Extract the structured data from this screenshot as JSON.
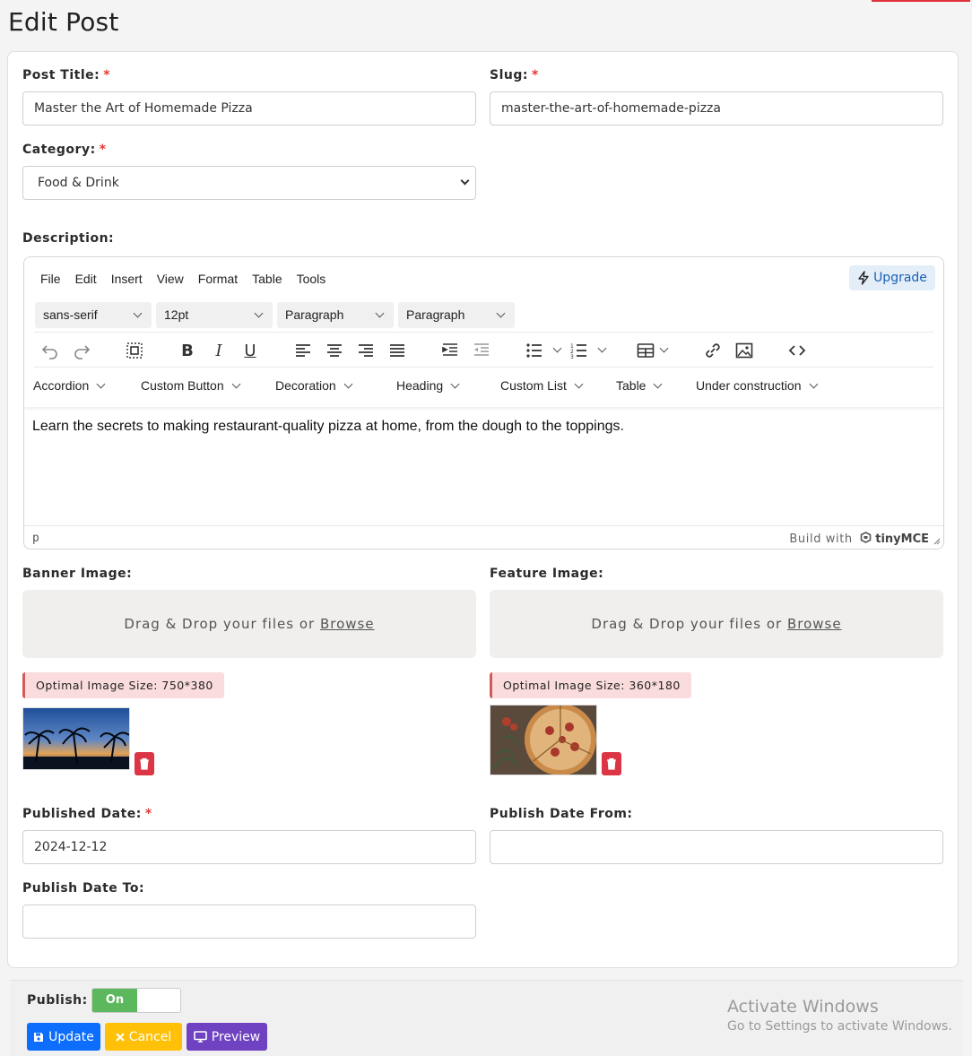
{
  "page": {
    "title": "Edit Post"
  },
  "form": {
    "post_title": {
      "label": "Post Title:",
      "required": "*",
      "value": "Master the Art of Homemade Pizza"
    },
    "slug": {
      "label": "Slug:",
      "required": "*",
      "value": "master-the-art-of-homemade-pizza"
    },
    "category": {
      "label": "Category:",
      "required": "*",
      "value": "Food & Drink"
    },
    "description": {
      "label": "Description:"
    },
    "banner_image": {
      "label": "Banner Image:",
      "drop_text": "Drag & Drop your files or",
      "browse": "Browse",
      "hint": "Optimal Image Size: 750*380"
    },
    "feature_image": {
      "label": "Feature Image:",
      "drop_text": "Drag & Drop your files or",
      "browse": "Browse",
      "hint": "Optimal Image Size: 360*180"
    },
    "published_date": {
      "label": "Published Date:",
      "required": "*",
      "value": "2024-12-12"
    },
    "publish_date_from": {
      "label": "Publish Date From:",
      "value": ""
    },
    "publish_date_to": {
      "label": "Publish Date To:",
      "value": ""
    }
  },
  "editor": {
    "menu": [
      "File",
      "Edit",
      "Insert",
      "View",
      "Format",
      "Table",
      "Tools"
    ],
    "upgrade": "Upgrade",
    "font_family": "sans-serif",
    "font_size": "12pt",
    "block_format_1": "Paragraph",
    "block_format_2": "Paragraph",
    "plugins": [
      "Accordion",
      "Custom Button",
      "Decoration",
      "Heading",
      "Custom List",
      "Table",
      "Under construction"
    ],
    "content": "Learn the secrets to making restaurant-quality pizza at home, from the dough to the toppings.",
    "status_path": "p",
    "brand_prefix": "Build with",
    "brand_name": "tinyMCE"
  },
  "footer": {
    "publish_label": "Publish:",
    "toggle_on": "On",
    "update": "Update",
    "cancel": "Cancel",
    "preview": "Preview"
  },
  "watermark": {
    "line1": "Activate Windows",
    "line2": "Go to Settings to activate Windows."
  },
  "colors": {
    "update": "#0d6efd",
    "cancel": "#ffc107",
    "preview": "#6f42c1",
    "toggle_on": "#5cb85c",
    "trash": "#dc3545",
    "upgrade_text": "#1a5fb4"
  }
}
